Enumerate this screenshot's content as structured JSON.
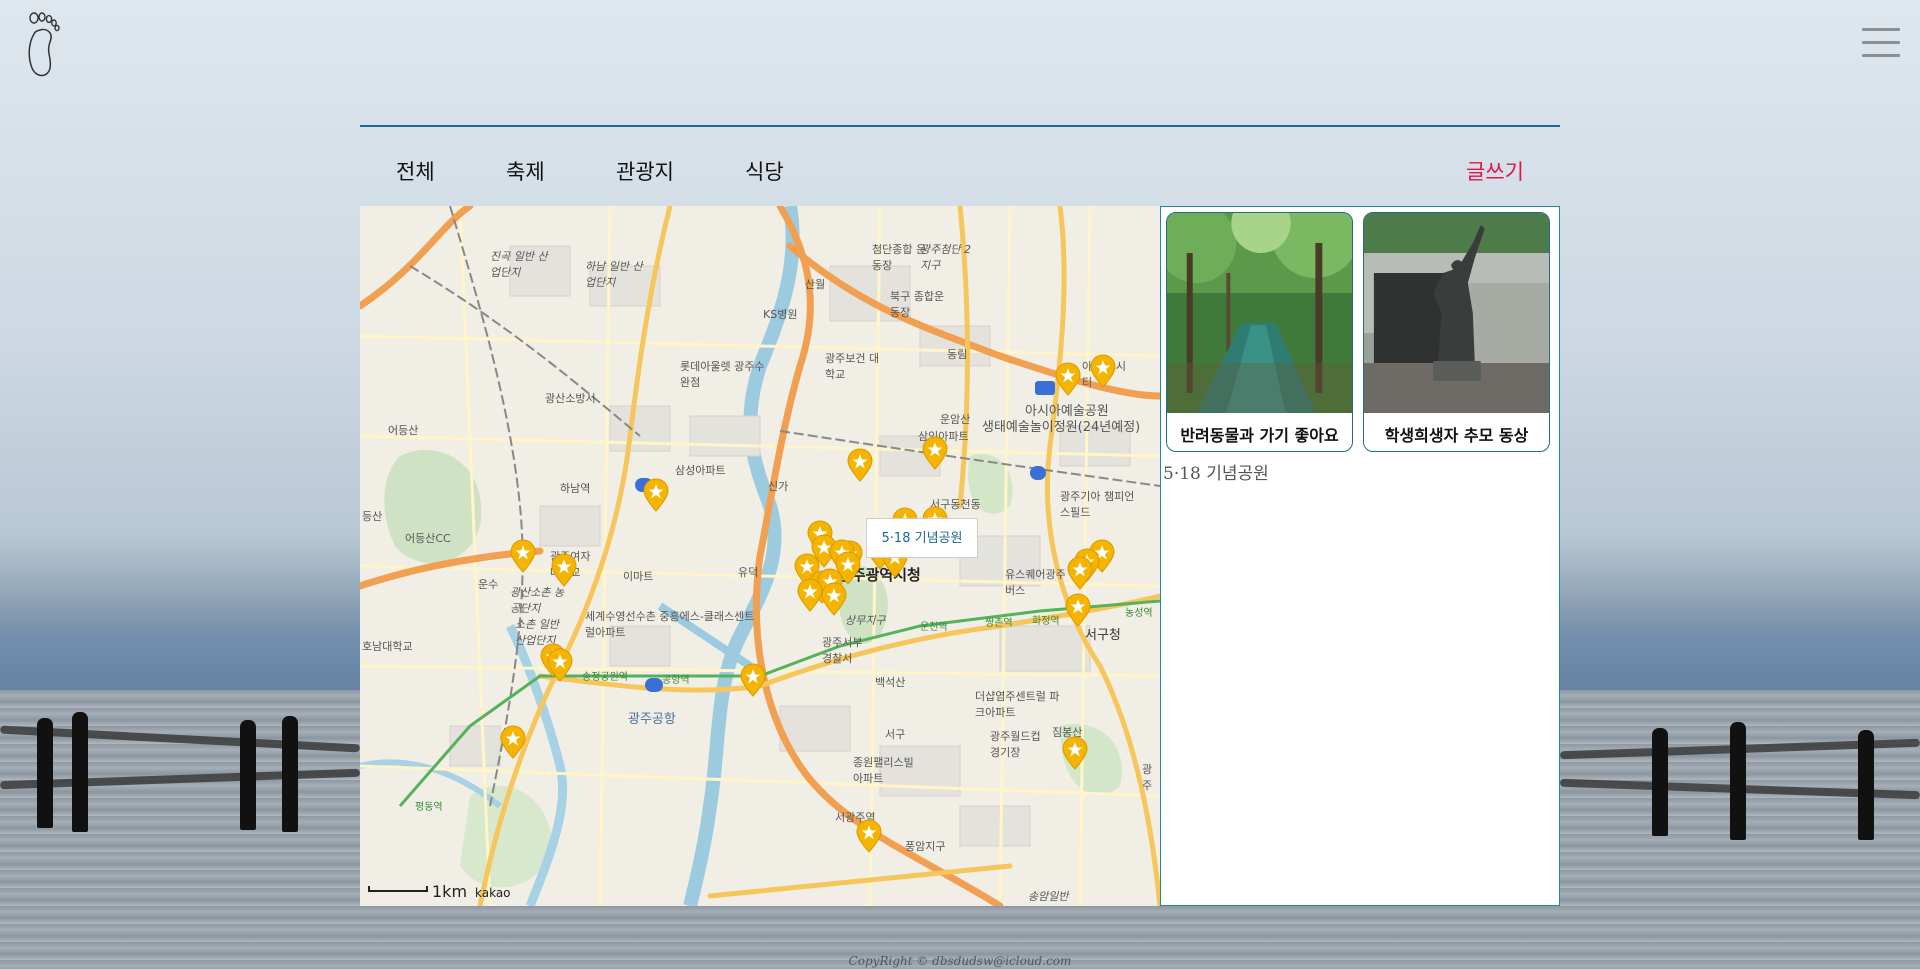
{
  "nav": {
    "tabs": [
      "전체",
      "축제",
      "관광지",
      "식당"
    ],
    "write_label": "글쓰기"
  },
  "map": {
    "tooltip": "5·18 기념공원",
    "scale_label": "1km",
    "provider": "kakao",
    "labels": [
      "진곡 일반 산업단지",
      "하남 일반 산업단지",
      "첨단종합 운동장",
      "광주첨단 2지구",
      "산월",
      "KS병원",
      "북구 종합운동장",
      "동림",
      "롯데아울렛 광주수완점",
      "광주보건 대학교",
      "광산소방서",
      "아쿠아 시티",
      "아시아예술공원",
      "생태예술놀이정원(24년예정)",
      "운암산",
      "삼익아파트",
      "어등산",
      "삼성아파트",
      "신가",
      "하남역",
      "서구동천동",
      "광주기아 챔피언스필드",
      "등산",
      "어등산CC",
      "광주여자 대학교",
      "운수",
      "이마트",
      "유덕",
      "광주광역시청",
      "유스퀘어광주 종합버스",
      "광산소촌 농공단지",
      "세계수영선수촌 중흥에스-클래스센트럴아파트",
      "소촌 일반 산업단지",
      "상무지구",
      "광주서부 경찰서",
      "서구청",
      "운천역",
      "쌍촌역",
      "화정역",
      "농성역",
      "호남대학교",
      "광주공항",
      "백석산",
      "송정공원역",
      "공항역",
      "더샵염주센트럴 파크아파트",
      "짐봉산",
      "서구",
      "광주월드컵 경기장",
      "종원팰리스빌 아파트",
      "평동역",
      "서광주역",
      "풍암지구",
      "송암일반",
      "광주"
    ]
  },
  "cards": [
    {
      "caption": "반려동물과 가기 좋아요",
      "image_icon": "forest-path-photo"
    },
    {
      "caption": "학생희생자 추모 동상",
      "image_icon": "memorial-statue-photo"
    }
  ],
  "selected_place": "5·18 기념공원",
  "footer": "CopyRight © dbsdudsw@icloud.com",
  "colors": {
    "accent_line": "#1b6b8a",
    "write_button": "#e0164a",
    "panel_border": "#1f8a96",
    "marker": "#f5b400"
  }
}
